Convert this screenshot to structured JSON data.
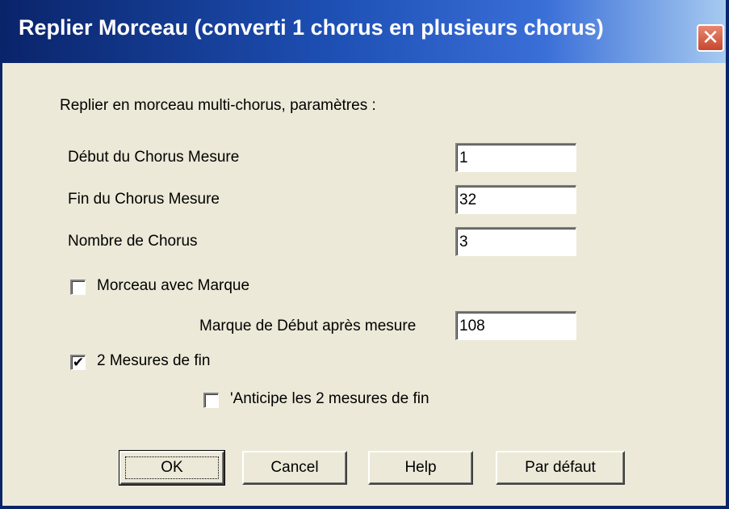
{
  "window": {
    "title": "Replier Morceau (converti 1 chorus en plusieurs chorus)",
    "close_glyph": "✕"
  },
  "form": {
    "heading": "Replier en morceau multi-chorus, paramètres :",
    "start_label": "Début du Chorus Mesure",
    "start_value": "1",
    "end_label": "Fin du Chorus Mesure",
    "end_value": "32",
    "count_label": "Nombre de Chorus",
    "count_value": "3",
    "tag_label": "Morceau avec Marque",
    "tag_checked": false,
    "tag_start_label": "Marque de Début après mesure",
    "tag_start_value": "108",
    "ending_label": "2 Mesures de fin",
    "ending_checked": true,
    "ending_checkmark": "✔",
    "anticipate_label": "'Anticipe les 2 mesures de fin",
    "anticipate_checked": false
  },
  "buttons": {
    "ok": "OK",
    "cancel": "Cancel",
    "help": "Help",
    "default": "Par défaut"
  }
}
